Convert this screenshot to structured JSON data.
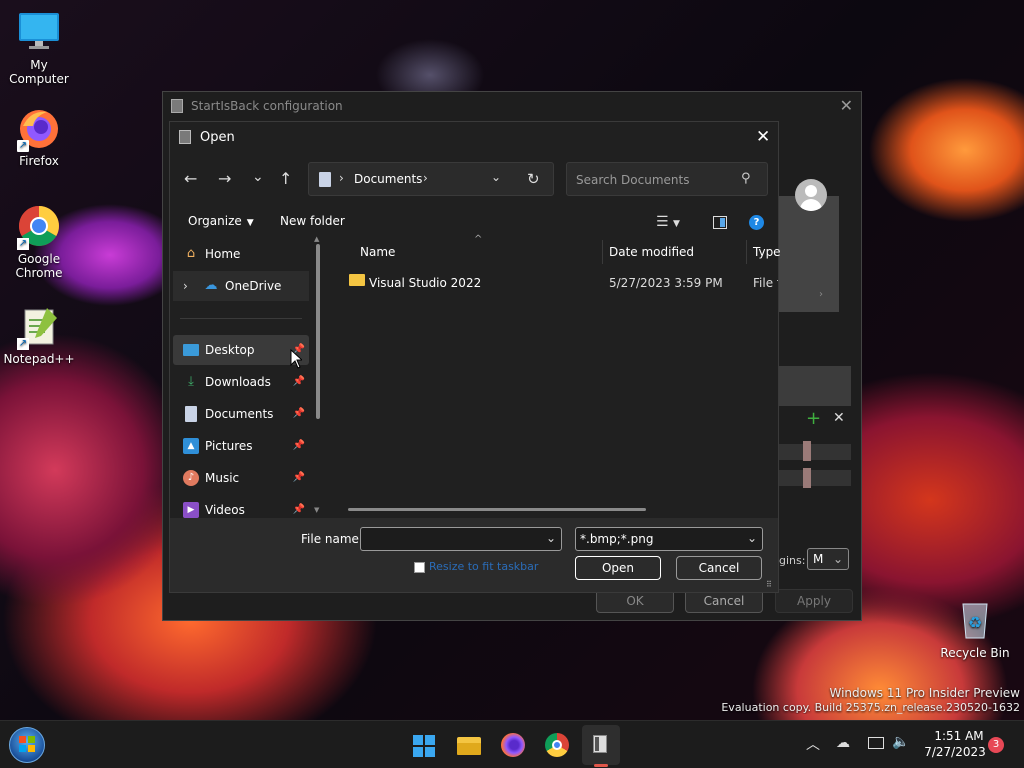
{
  "desktop": {
    "icons": [
      {
        "label": "My Computer",
        "icon": "monitor-icon"
      },
      {
        "label": "Firefox",
        "icon": "firefox-icon"
      },
      {
        "label": "Google Chrome",
        "icon": "chrome-icon"
      },
      {
        "label": "Notepad++",
        "icon": "notepadpp-icon"
      },
      {
        "label": "Recycle Bin",
        "icon": "recycle-bin-icon"
      }
    ],
    "watermark": {
      "line1": "Windows 11 Pro Insider Preview",
      "line2": "Evaluation copy. Build 25375.zn_release.230520-1632"
    }
  },
  "back_window": {
    "title": "StartIsBack configuration",
    "ok_label": "OK",
    "cancel_label": "Cancel",
    "apply_label": "Apply",
    "margins_label": "gins:",
    "margins_value": "M"
  },
  "dialog": {
    "title": "Open",
    "breadcrumb": {
      "location": "Documents"
    },
    "search": {
      "placeholder": "Search Documents"
    },
    "toolbar": {
      "organize_label": "Organize",
      "new_folder_label": "New folder"
    },
    "nav_pane": {
      "items": [
        {
          "label": "Home",
          "icon": "home-icon",
          "pinned": false
        },
        {
          "label": "OneDrive",
          "icon": "cloud-icon",
          "pinned": false
        },
        {
          "label": "Desktop",
          "icon": "desktop-icon",
          "pinned": true,
          "selected": true
        },
        {
          "label": "Downloads",
          "icon": "download-icon",
          "pinned": true
        },
        {
          "label": "Documents",
          "icon": "document-icon",
          "pinned": true
        },
        {
          "label": "Pictures",
          "icon": "pictures-icon",
          "pinned": true
        },
        {
          "label": "Music",
          "icon": "music-icon",
          "pinned": true
        },
        {
          "label": "Videos",
          "icon": "videos-icon",
          "pinned": true
        }
      ]
    },
    "file_list": {
      "columns": [
        "Name",
        "Date modified",
        "Type"
      ],
      "rows": [
        {
          "name": "Visual Studio 2022",
          "date_modified": "5/27/2023 3:59 PM",
          "type": "File fo"
        }
      ]
    },
    "file_name_label": "File name:",
    "file_name_value": "",
    "file_type_value": "*.bmp;*.png",
    "resize_checkbox_label": "Resize to fit taskbar",
    "open_label": "Open",
    "cancel_label": "Cancel"
  },
  "taskbar": {
    "time": "1:51 AM",
    "date": "7/27/2023",
    "notification_count": "3"
  },
  "colors": {
    "accent": "#0078d4",
    "dialog_bg": "#202020",
    "taskbar_bg": "#1c1c1c",
    "badge": "#e74856"
  }
}
